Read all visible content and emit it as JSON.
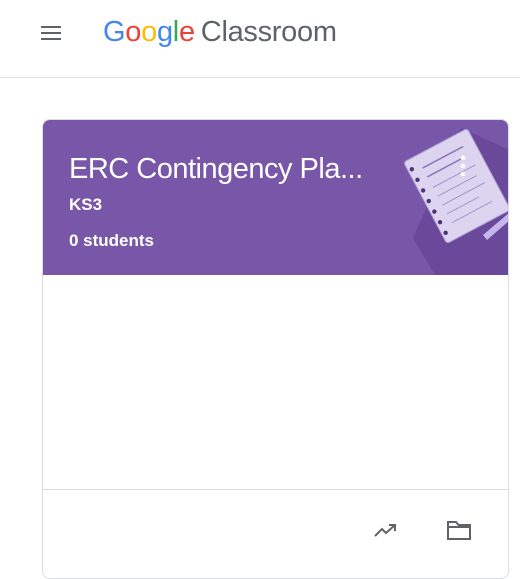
{
  "header": {
    "menu_icon": "hamburger-menu-icon",
    "logo_letters": [
      "G",
      "o",
      "o",
      "g",
      "l",
      "e"
    ],
    "logo_colors": [
      "#4285F4",
      "#EA4335",
      "#FBBC05",
      "#4285F4",
      "#34A853",
      "#EA4335"
    ],
    "product_name": "Classroom"
  },
  "class_card": {
    "title": "ERC Contingency Pla...",
    "section": "KS3",
    "student_count": "0 students",
    "header_color": "#7856a8",
    "illustration": "notebook-illustration",
    "more_icon": "more-vert-icon",
    "footer_icons": [
      "trending-up-icon",
      "folder-icon"
    ]
  }
}
